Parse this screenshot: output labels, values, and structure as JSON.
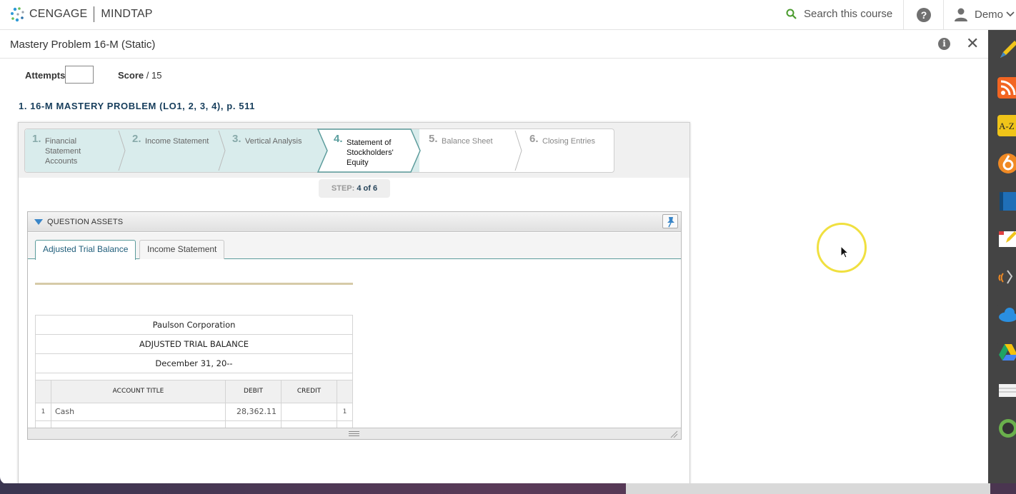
{
  "header": {
    "brand_left": "CENGAGE",
    "brand_right": "MINDTAP",
    "search_placeholder": "Search this course",
    "help_label": "?",
    "user_name": "Demo"
  },
  "activity": {
    "title": "Mastery Problem 16-M (Static)",
    "info_label": "i",
    "close_label": "✕"
  },
  "meta": {
    "attempts_label": "Attempts",
    "score_label": "Score",
    "score_value": "/ 15"
  },
  "question": {
    "title": "1. 16-M MASTERY PROBLEM (LO1, 2, 3, 4), p. 511"
  },
  "steps": [
    {
      "num": "1.",
      "label": "Financial Statement Accounts",
      "state": "done"
    },
    {
      "num": "2.",
      "label": "Income Statement",
      "state": "done"
    },
    {
      "num": "3.",
      "label": "Vertical Analysis",
      "state": "done"
    },
    {
      "num": "4.",
      "label": "Statement of Stockholders' Equity",
      "state": "current"
    },
    {
      "num": "5.",
      "label": "Balance Sheet",
      "state": "future"
    },
    {
      "num": "6.",
      "label": "Closing Entries",
      "state": "future"
    }
  ],
  "step_counter": {
    "prefix": "STEP:",
    "value": "4 of 6"
  },
  "assets": {
    "header": "QUESTION ASSETS",
    "tabs": [
      {
        "label": "Adjusted Trial Balance",
        "active": true
      },
      {
        "label": "Income Statement",
        "active": false
      }
    ]
  },
  "trial_balance": {
    "company": "Paulson Corporation",
    "title": "ADJUSTED TRIAL BALANCE",
    "date": "December 31, 20--",
    "columns": [
      "ACCOUNT TITLE",
      "DEBIT",
      "CREDIT"
    ],
    "rows": [
      {
        "line": "1",
        "account": "Cash",
        "debit": "28,362.11",
        "credit": "",
        "line_right": "1"
      }
    ]
  },
  "colors": {
    "step_done_bg": "#d9ecec",
    "accent_teal": "#5c9c9c",
    "question_title": "#173e5c",
    "cursor_ring": "#f0e040"
  }
}
